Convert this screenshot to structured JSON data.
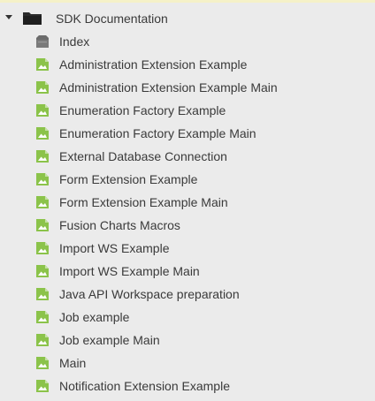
{
  "tree": {
    "root": {
      "label": "SDK Documentation",
      "icon": "folder-icon",
      "expanded": true
    },
    "children": [
      {
        "label": "Index",
        "icon": "index-page-icon"
      },
      {
        "label": "Administration Extension Example",
        "icon": "page-icon"
      },
      {
        "label": "Administration Extension Example Main",
        "icon": "page-icon"
      },
      {
        "label": "Enumeration Factory Example",
        "icon": "page-icon"
      },
      {
        "label": "Enumeration Factory Example Main",
        "icon": "page-icon"
      },
      {
        "label": "External Database Connection",
        "icon": "page-icon"
      },
      {
        "label": "Form Extension Example",
        "icon": "page-icon"
      },
      {
        "label": "Form Extension Example Main",
        "icon": "page-icon"
      },
      {
        "label": "Fusion Charts Macros",
        "icon": "page-icon"
      },
      {
        "label": "Import WS Example",
        "icon": "page-icon"
      },
      {
        "label": "Import WS Example Main",
        "icon": "page-icon"
      },
      {
        "label": "Java API Workspace preparation",
        "icon": "page-icon"
      },
      {
        "label": "Job example",
        "icon": "page-icon"
      },
      {
        "label": "Job example Main",
        "icon": "page-icon"
      },
      {
        "label": "Main",
        "icon": "page-icon"
      },
      {
        "label": "Notification Extension Example",
        "icon": "page-icon"
      }
    ]
  },
  "colors": {
    "background": "#ebebeb",
    "text": "#3a3a3a",
    "page_icon": "#8bc34a",
    "folder_icon": "#2b2b2b",
    "index_icon": "#6b6b6b"
  }
}
